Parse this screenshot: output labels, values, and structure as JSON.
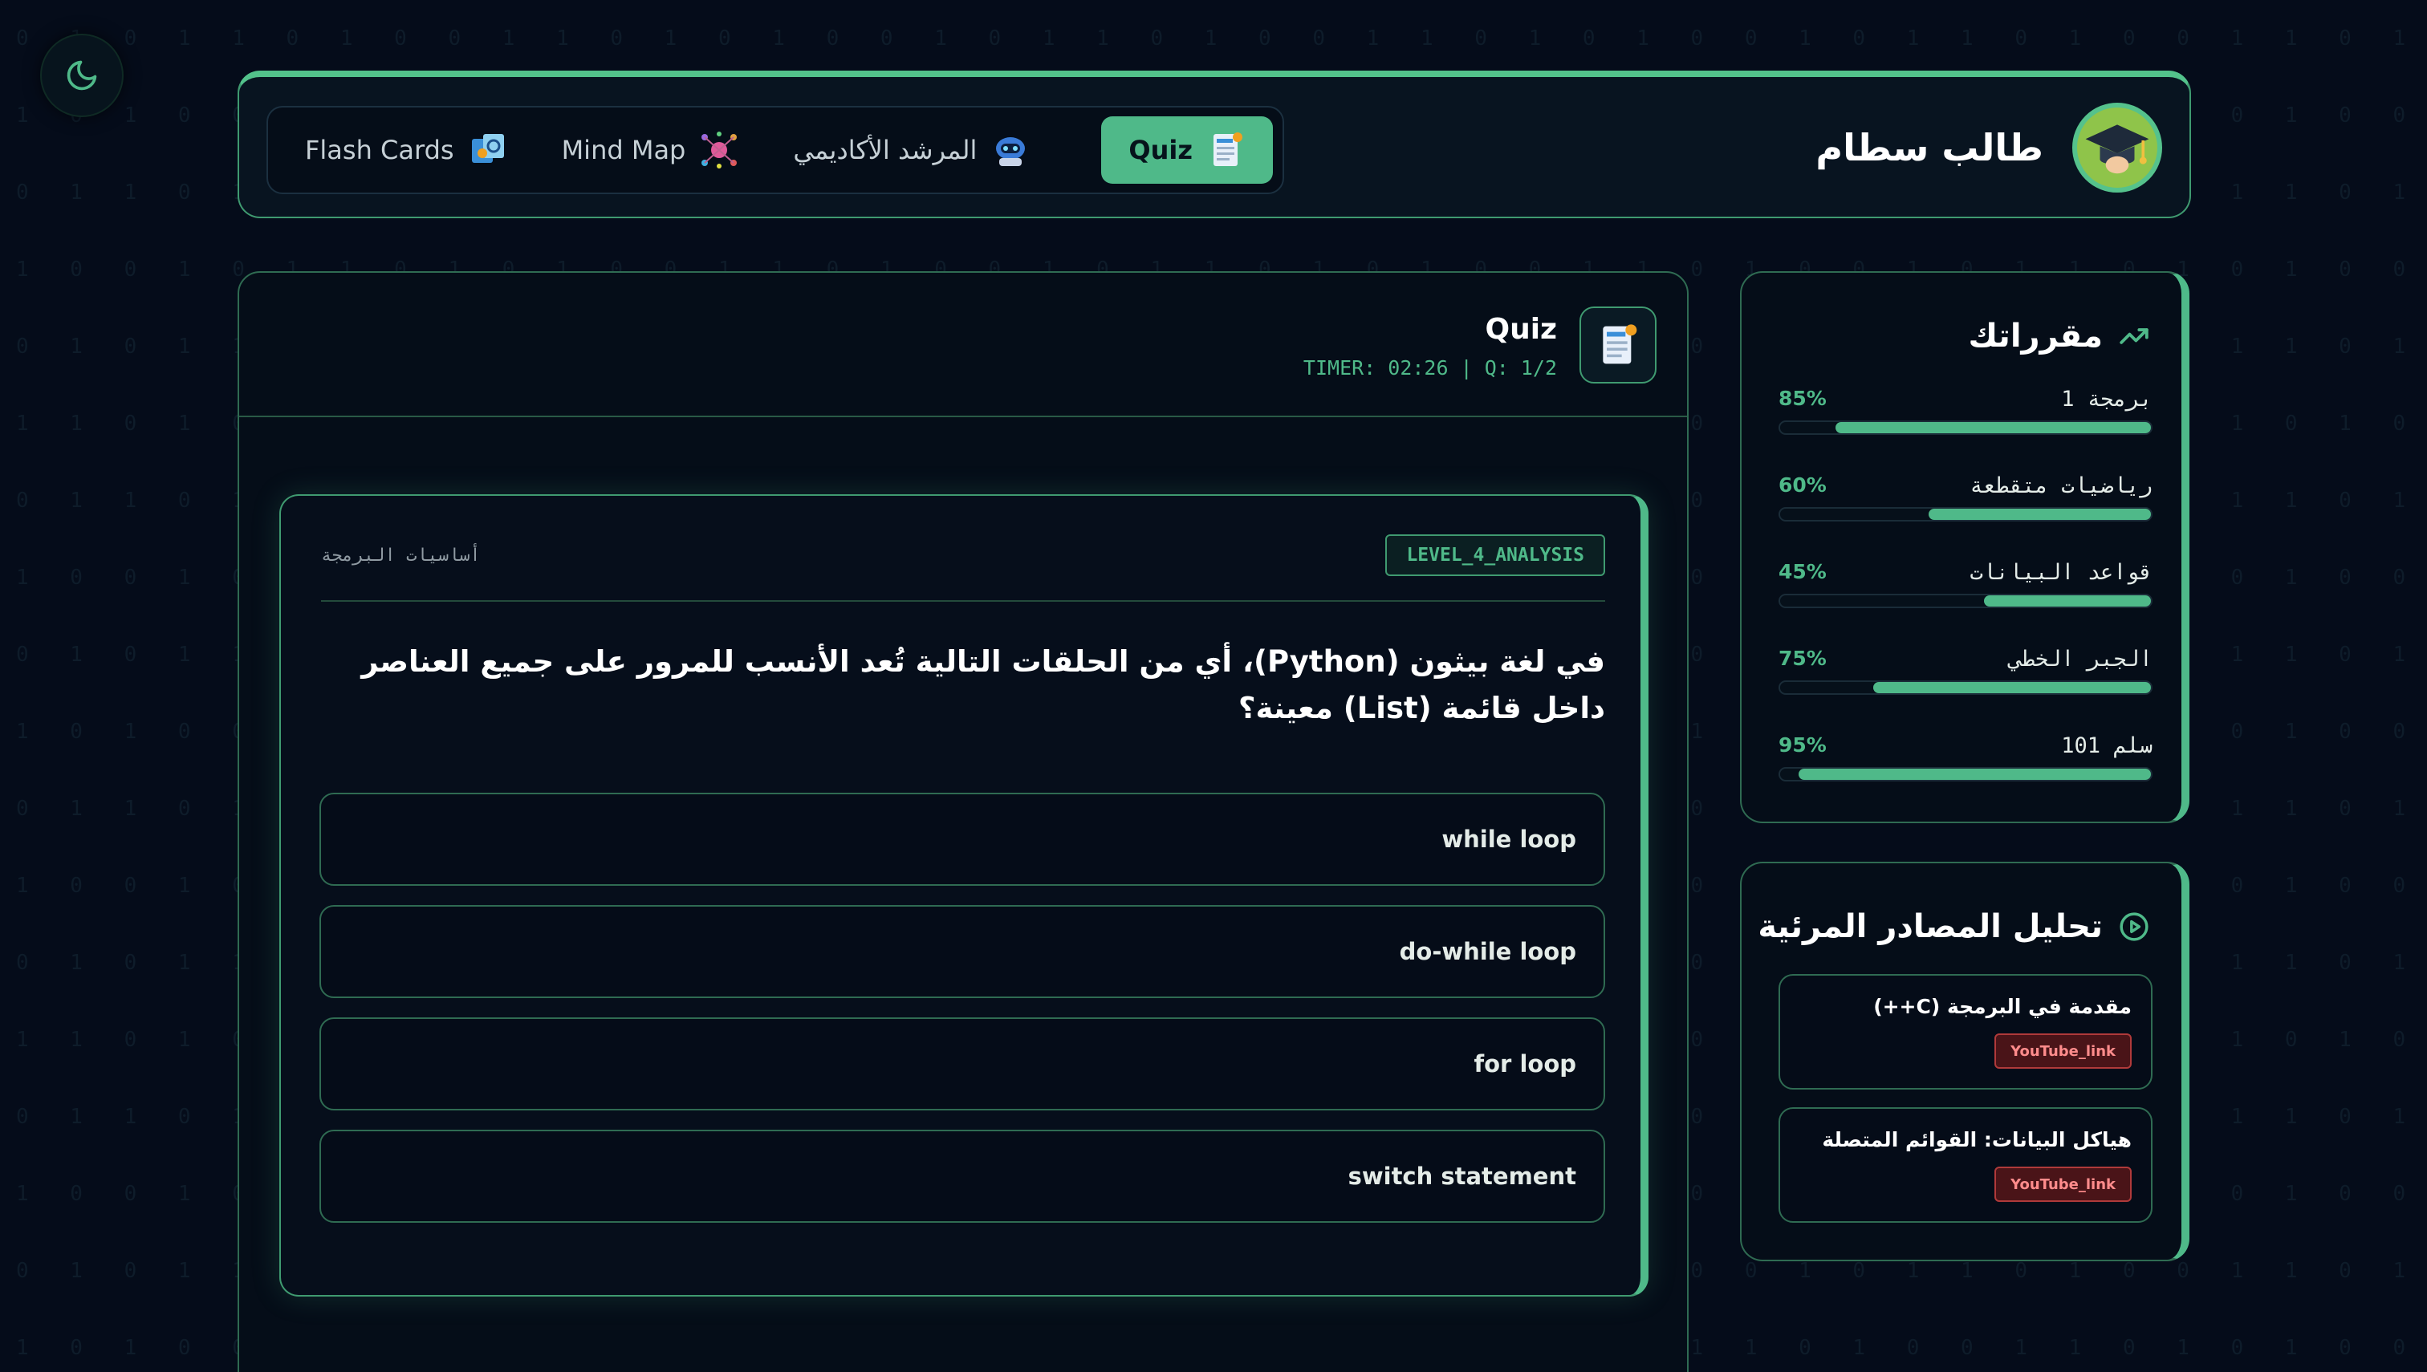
{
  "header": {
    "user_name": "طالب سطام",
    "nav": [
      {
        "label": "Quiz",
        "icon": "quiz-icon",
        "active": true
      },
      {
        "label": "المرشد الأكاديمي",
        "icon": "robot-icon",
        "active": false
      },
      {
        "label": "Mind Map",
        "icon": "mind-map-icon",
        "active": false
      },
      {
        "label": "Flash Cards",
        "icon": "flash-cards-icon",
        "active": false
      }
    ]
  },
  "quiz": {
    "title": "Quiz",
    "timer": "TIMER: 02:26 | Q: 1/2",
    "level": "LEVEL_4_ANALYSIS",
    "subject": "أساسيات البرمجة",
    "question": "في لغة بيثون (Python)، أي من الحلقات التالية تُعد الأنسب للمرور على جميع العناصر داخل قائمة (List) معينة؟",
    "options": [
      "while loop",
      "do-while loop",
      "for loop",
      "switch statement"
    ]
  },
  "courses": {
    "title": "مقرراتك",
    "items": [
      {
        "name": "برمجة 1",
        "percent_label": "85%",
        "progress": 0.85
      },
      {
        "name": "رياضيات متقطعة",
        "percent_label": "60%",
        "progress": 0.6
      },
      {
        "name": "قواعد البيانات",
        "percent_label": "45%",
        "progress": 0.45
      },
      {
        "name": "الجبر الخطي",
        "percent_label": "75%",
        "progress": 0.75
      },
      {
        "name": "سلم 101",
        "percent_label": "95%",
        "progress": 0.95
      }
    ]
  },
  "videos": {
    "title": "تحليل المصادر المرئية",
    "items": [
      {
        "title": "مقدمة في البرمجة (C++)",
        "badge": "YouTube_link"
      },
      {
        "title": "هياكل البيانات: القوائم المتصلة",
        "badge": "YouTube_link"
      }
    ]
  },
  "colors": {
    "accent": "#4fb989",
    "background": "#050c1a",
    "badge_red": "#b03a3a"
  }
}
